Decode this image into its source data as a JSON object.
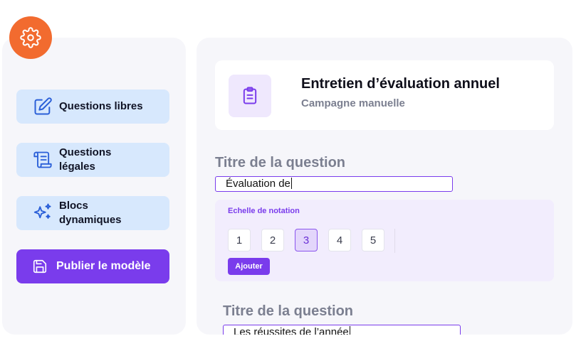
{
  "sidebar": {
    "items": [
      {
        "label": "Questions libres",
        "icon": "edit-icon"
      },
      {
        "label": "Questions légales",
        "icon": "scroll-icon"
      },
      {
        "label": "Blocs dynamiques",
        "icon": "sparkles-icon"
      }
    ],
    "publish_label": "Publier le modèle",
    "publish_icon": "save-icon"
  },
  "settings_icon": "gear-icon",
  "header": {
    "title": "Entretien d’évaluation annuel",
    "subtitle": "Campagne manuelle",
    "icon": "clipboard-icon"
  },
  "questions": [
    {
      "label": "Titre de la question",
      "value": "Évaluation de",
      "scale": {
        "title": "Echelle de notation",
        "options": [
          "1",
          "2",
          "3",
          "4",
          "5"
        ],
        "selected": "3",
        "add_label": "Ajouter"
      }
    },
    {
      "label": "Titre de la question",
      "value": "Les réussites de l’année"
    }
  ],
  "colors": {
    "accent": "#7a3cec",
    "settings_button": "#f26b2f",
    "sidebar_button": "#d7e8fd",
    "icon_blue": "#2a5fd8",
    "panel_background": "#f6f6fa"
  }
}
